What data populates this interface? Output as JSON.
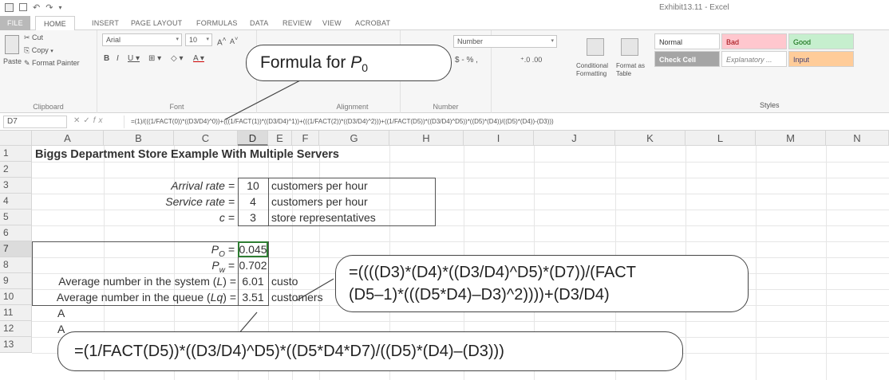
{
  "window": {
    "title": "Exhibit13.11 - Excel",
    "qat_icons": [
      "excel-icon",
      "save-icon",
      "undo-icon",
      "redo-icon"
    ]
  },
  "tabs": [
    "FILE",
    "HOME",
    "INSERT",
    "PAGE LAYOUT",
    "FORMULAS",
    "DATA",
    "REVIEW",
    "VIEW",
    "ACROBAT"
  ],
  "ribbon": {
    "clipboard": {
      "paste": "Paste",
      "cut": "Cut",
      "copy": "Copy",
      "format_painter": "Format Painter",
      "label": "Clipboard"
    },
    "font": {
      "name": "Arial",
      "size": "10",
      "label": "Font"
    },
    "alignment": {
      "label": "Alignment"
    },
    "number": {
      "format": "Number",
      "symbols": "$ - % ,",
      "label": "Number"
    },
    "styles_group": {
      "conditional": "Conditional Formatting",
      "format_table": "Format as Table",
      "label": "Styles"
    },
    "styles": [
      {
        "name": "Normal",
        "color": "#ffffff",
        "text": "#333333"
      },
      {
        "name": "Bad",
        "color": "#ffc7ce",
        "text": "#9c0006"
      },
      {
        "name": "Good",
        "color": "#c6efce",
        "text": "#006100"
      },
      {
        "name": "Check Cell",
        "color": "#a5a5a5",
        "text": "#ffffff"
      },
      {
        "name": "Explanatory ...",
        "color": "#ffffff",
        "text": "#7f7f7f"
      },
      {
        "name": "Input",
        "color": "#ffcc99",
        "text": "#3f3f76"
      }
    ]
  },
  "formula_bar": {
    "name_box": "D7",
    "fx": "fx",
    "formula": "=(1)/(((1/FACT(0))*((D3/D4)^0))+(((1/FACT(1))*((D3/D4)^1))+(((1/FACT(2))*((D3/D4)^2)))+((1/FACT(D5))*((D3/D4)^D5))*((D5)*(D4))/((D5)*(D4))-(D3)))"
  },
  "grid": {
    "columns": [
      "A",
      "B",
      "C",
      "D",
      "E",
      "F",
      "G",
      "H",
      "I",
      "J",
      "K",
      "L",
      "M",
      "N"
    ],
    "rows": [
      "1",
      "2",
      "3",
      "4",
      "5",
      "6",
      "7",
      "8",
      "9",
      "10",
      "11",
      "12",
      "13"
    ],
    "selected_column": "D",
    "selected_row": "7",
    "title": "Biggs Department Store Example With Multiple Servers",
    "arrival_label": "Arrival rate =",
    "arrival_value": "10",
    "arrival_unit": "customers per hour",
    "service_label": "Service rate =",
    "service_value": "4",
    "service_unit": "customers per hour",
    "c_label": "c =",
    "c_value": "3",
    "c_unit": "store representatives",
    "p0_label": "P",
    "p0_sub": "O",
    "p0_value": "0.045",
    "pw_label": "P",
    "pw_sub": "w",
    "pw_value": "0.702",
    "L_label_pre": "Average number in the system (",
    "L_sym": "L",
    "L_label_post": ") =",
    "L_value": "6.01",
    "L_unit": "custo",
    "Lq_label_pre": "Average number in the queue (",
    "Lq_sym": "Lq",
    "Lq_label_post": ") =",
    "Lq_value": "3.51",
    "Lq_unit": "customers",
    "row11_a": "A",
    "row12_a": "A"
  },
  "callouts": {
    "p0": {
      "text": "Formula for ",
      "sym": "P",
      "sub": "0"
    },
    "L": {
      "line1": "=((((D3)*(D4)*((D3/D4)^D5)*(D7))/(FACT",
      "line2": "(D5–1)*(((D5*D4)–D3)^2))))+(D3/D4)"
    },
    "pw": {
      "text": "=(1/FACT(D5))*((D3/D4)^D5)*((D5*D4*D7)/((D5)*(D4)–(D3)))"
    }
  }
}
